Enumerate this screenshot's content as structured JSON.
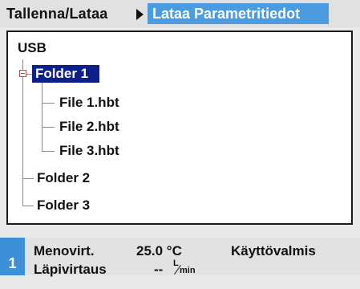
{
  "breadcrumb": {
    "parent": "Tallenna/Lataa",
    "current": "Lataa Parametritiedot"
  },
  "tree": {
    "root": "USB",
    "folders": [
      {
        "label": "Folder 1",
        "expanded": true,
        "selected": true,
        "files": [
          "File 1.hbt",
          "File 2.hbt",
          "File 3.hbt"
        ]
      },
      {
        "label": "Folder 2"
      },
      {
        "label": "Folder 3"
      }
    ]
  },
  "status": {
    "channel": "1",
    "row1_label": "Menovirt.",
    "row1_value": "25.0 °C",
    "row2_label": "Läpivirtaus",
    "row2_value": "--",
    "row2_unit_top": "L",
    "row2_unit_bottom": "min",
    "state": "Käyttövalmis"
  },
  "colors": {
    "breadcrumb_highlight": "#4a9be0",
    "selection": "#0d1f8a",
    "channel_badge": "#3d8fd8"
  }
}
